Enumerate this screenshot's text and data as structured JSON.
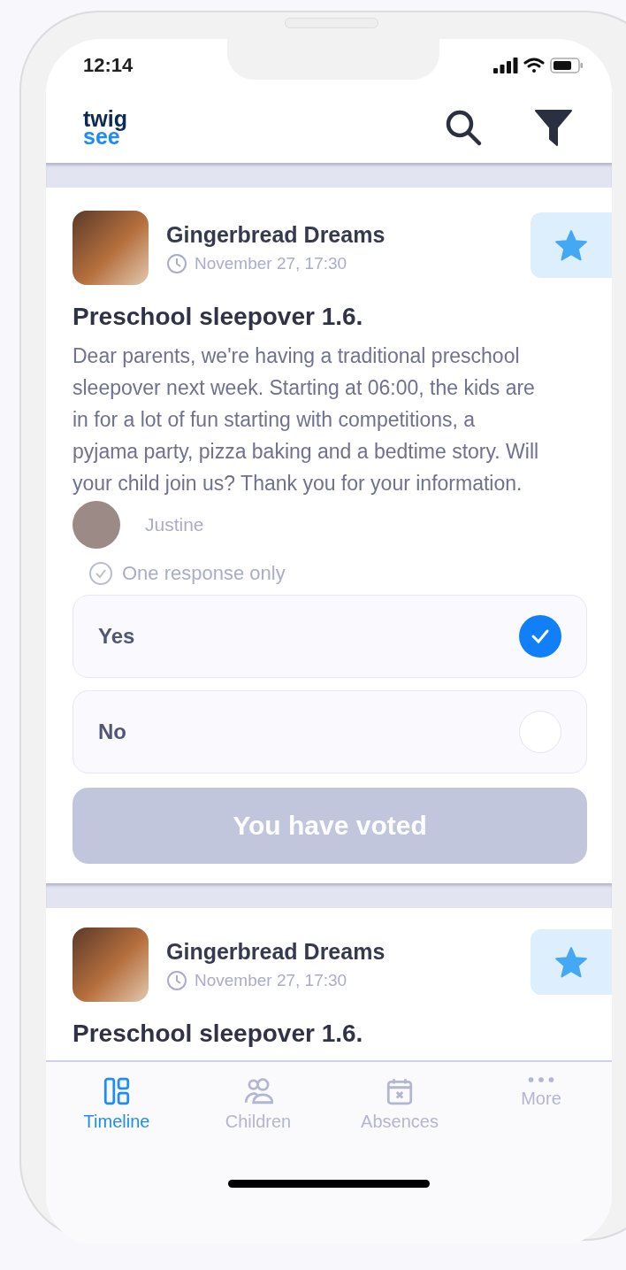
{
  "status_bar": {
    "time": "12:14"
  },
  "header": {
    "logo": {
      "line_1": "twig",
      "line_2": "see"
    }
  },
  "posts": [
    {
      "author": "Gingerbread Dreams",
      "time": "November 27, 17:30",
      "starred": true,
      "title": "Preschool sleepover 1.6.",
      "body": "Dear parents, we're having a traditional preschool sleepover next week. Starting at 06:00, the kids are in for a lot of fun starting with competitions, a pyjama party, pizza baking and a bedtime story. Will your child join us? Thank you for your information.",
      "sender": "Justine",
      "poll": {
        "note": "One response only",
        "options": [
          {
            "label": "Yes",
            "selected": true
          },
          {
            "label": "No",
            "selected": false
          }
        ],
        "button": {
          "label": "You have voted",
          "disabled": true
        }
      }
    },
    {
      "author": "Gingerbread Dreams",
      "time": "November 27, 17:30",
      "starred": true,
      "title": "Preschool sleepover 1.6."
    }
  ],
  "tabs": [
    {
      "label": "Timeline",
      "selected": true
    },
    {
      "label": "Children",
      "selected": false
    },
    {
      "label": "Absences",
      "selected": false
    },
    {
      "label": "More",
      "selected": false
    }
  ]
}
